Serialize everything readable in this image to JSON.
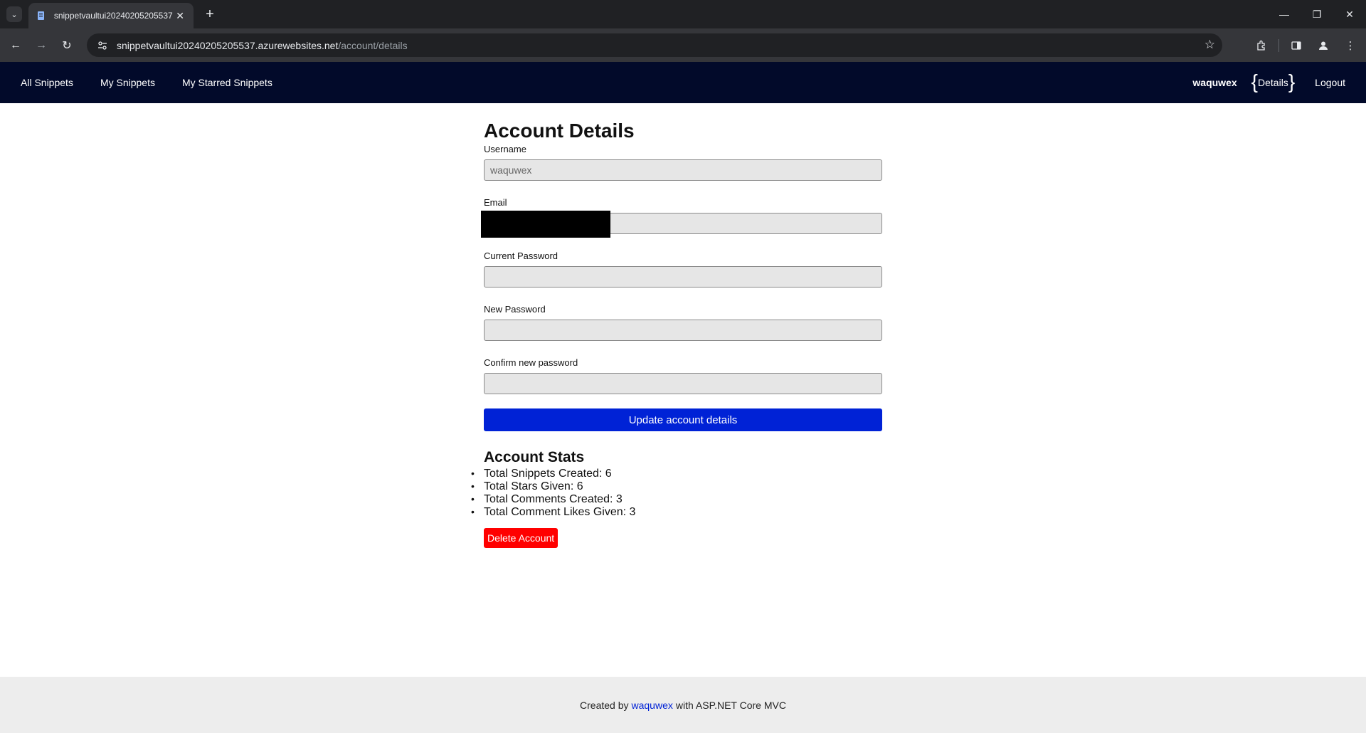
{
  "browser": {
    "tab_title": "snippetvaultui20240205205537",
    "new_tab_symbol": "+",
    "url_host": "snippetvaultui20240205205537.azurewebsites.net",
    "url_path": "/account/details"
  },
  "nav": {
    "links": [
      "All Snippets",
      "My Snippets",
      "My Starred Snippets"
    ],
    "username": "waquwex",
    "details_label": "Details",
    "logout_label": "Logout"
  },
  "form": {
    "title": "Account Details",
    "username_label": "Username",
    "username_value": "waquwex",
    "email_label": "Email",
    "current_password_label": "Current Password",
    "new_password_label": "New Password",
    "confirm_password_label": "Confirm new password",
    "update_button": "Update account details"
  },
  "stats": {
    "title": "Account Stats",
    "items": [
      "Total Snippets Created: 6",
      "Total Stars Given: 6",
      "Total Comments Created: 3",
      "Total Comment Likes Given: 3"
    ],
    "delete_button": "Delete Account"
  },
  "footer": {
    "prefix": "Created by",
    "author": "waquwex",
    "suffix": "with ASP.NET Core MVC"
  },
  "colors": {
    "navbar_bg": "#020a2a",
    "primary": "#0022d6",
    "danger": "#ff0000",
    "footer_bg": "#ededed"
  }
}
